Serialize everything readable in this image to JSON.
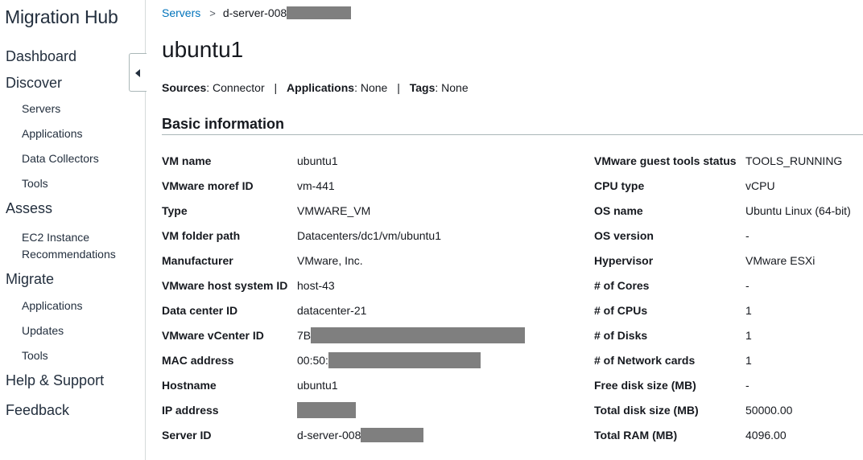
{
  "app": {
    "title": "Migration Hub"
  },
  "sidebar": {
    "dashboard": "Dashboard",
    "discover": "Discover",
    "discover_items": [
      "Servers",
      "Applications",
      "Data Collectors",
      "Tools"
    ],
    "assess": "Assess",
    "assess_items": [
      "EC2 Instance",
      "Recommendations"
    ],
    "migrate": "Migrate",
    "migrate_items": [
      "Applications",
      "Updates",
      "Tools"
    ],
    "help": "Help & Support",
    "feedback": "Feedback"
  },
  "breadcrumb": {
    "parent": "Servers",
    "separator": ">",
    "current": "d-server-008"
  },
  "page": {
    "title": "ubuntu1",
    "sources_label": "Sources",
    "sources_value": ": Connector",
    "applications_label": "Applications",
    "applications_value": ": None",
    "tags_label": "Tags",
    "tags_value": ": None",
    "divider": "|"
  },
  "section": {
    "title": "Basic information"
  },
  "details_left": [
    {
      "label": "VM name",
      "value": "ubuntu1"
    },
    {
      "label": "VMware moref ID",
      "value": "vm-441"
    },
    {
      "label": "Type",
      "value": "VMWARE_VM"
    },
    {
      "label": "VM folder path",
      "value": "Datacenters/dc1/vm/ubuntu1"
    },
    {
      "label": "Manufacturer",
      "value": "VMware, Inc."
    },
    {
      "label": "VMware host system ID",
      "value": "host-43"
    },
    {
      "label": "Data center ID",
      "value": "datacenter-21"
    },
    {
      "label": "VMware vCenter ID",
      "value": "7B"
    },
    {
      "label": "MAC address",
      "value": "00:50:"
    },
    {
      "label": "Hostname",
      "value": "ubuntu1"
    },
    {
      "label": "IP address",
      "value": ""
    },
    {
      "label": "Server ID",
      "value": "d-server-008"
    }
  ],
  "details_right": [
    {
      "label": "VMware guest tools status",
      "value": "TOOLS_RUNNING"
    },
    {
      "label": "CPU type",
      "value": "vCPU"
    },
    {
      "label": "OS name",
      "value": "Ubuntu Linux (64-bit)"
    },
    {
      "label": "OS version",
      "value": "-"
    },
    {
      "label": "Hypervisor",
      "value": "VMware ESXi"
    },
    {
      "label": "# of Cores",
      "value": "-"
    },
    {
      "label": "# of CPUs",
      "value": "1"
    },
    {
      "label": "# of Disks",
      "value": "1"
    },
    {
      "label": "# of Network cards",
      "value": "1"
    },
    {
      "label": "Free disk size (MB)",
      "value": "-"
    },
    {
      "label": "Total disk size (MB)",
      "value": "50000.00"
    },
    {
      "label": "Total RAM (MB)",
      "value": "4096.00"
    }
  ],
  "colors": {
    "link": "#0073bb",
    "redaction": "#7f7f7f",
    "rule": "#aab7b8"
  }
}
